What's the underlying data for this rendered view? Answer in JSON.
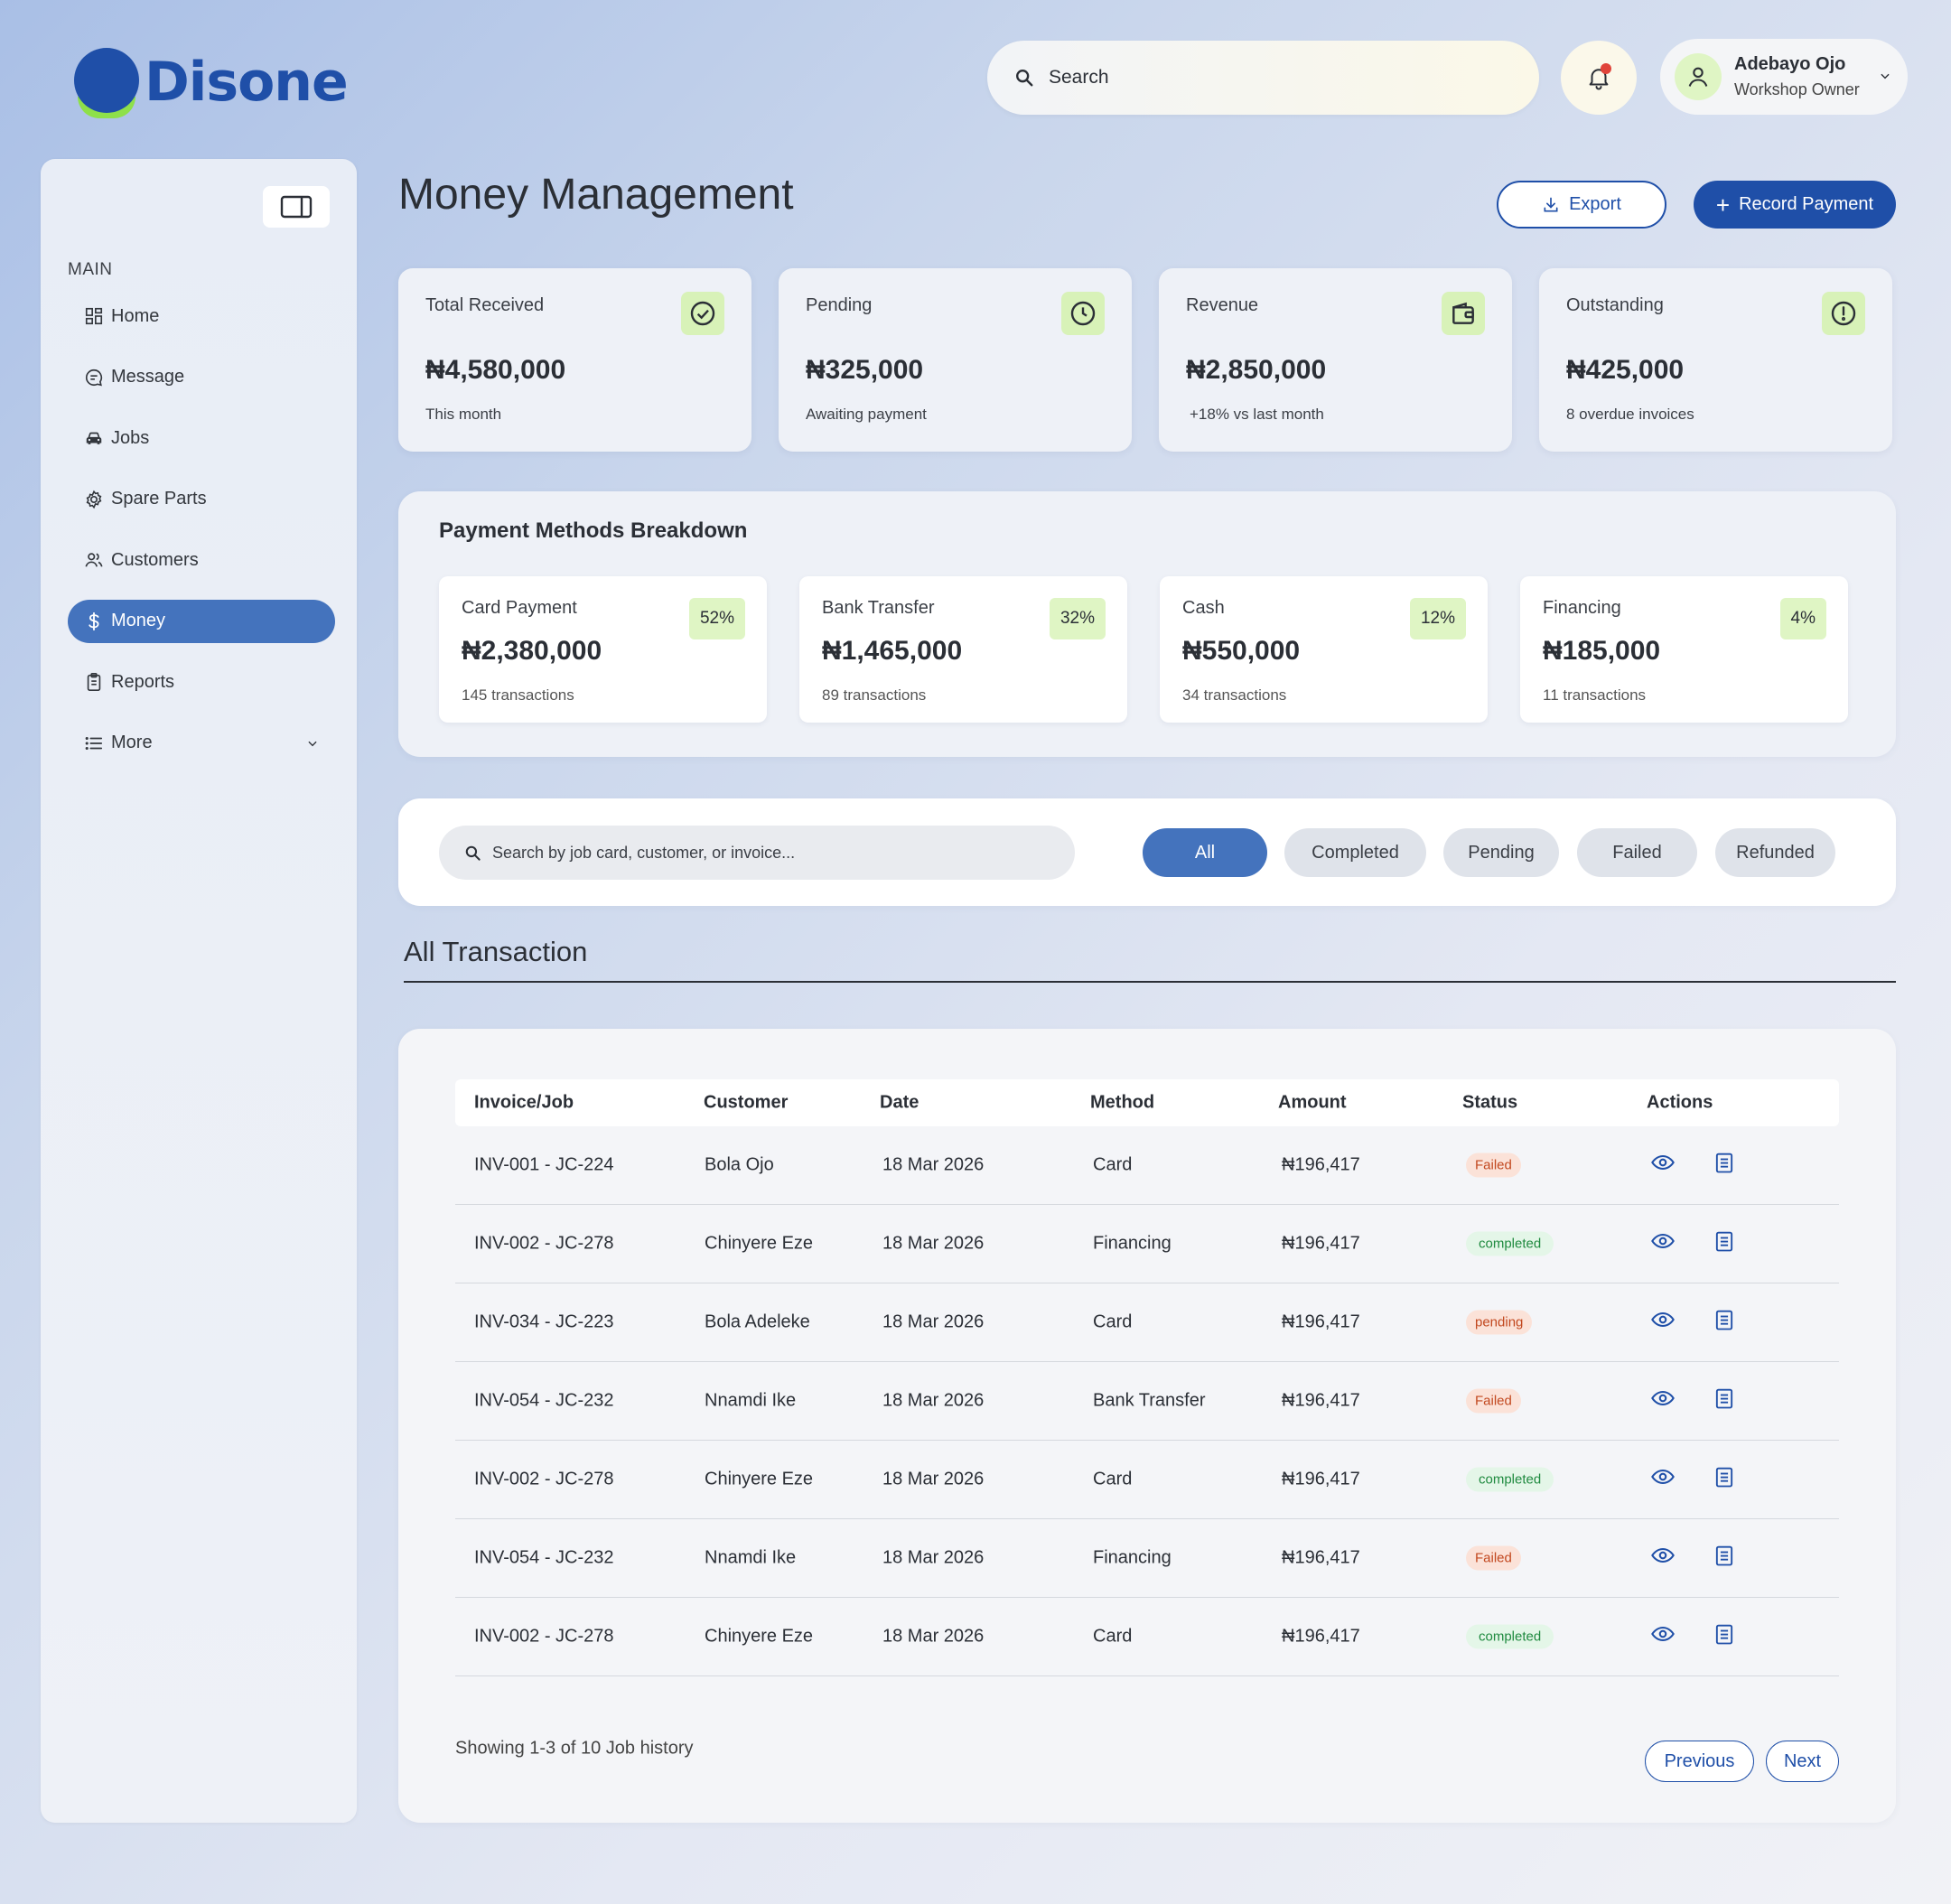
{
  "brand": {
    "name": "Disone"
  },
  "header": {
    "search_placeholder": "Search",
    "user": {
      "name": "Adebayo Ojo",
      "role": "Workshop Owner"
    }
  },
  "sidebar": {
    "section_label": "MAIN",
    "items": [
      {
        "label": "Home",
        "icon": "grid-icon"
      },
      {
        "label": "Message",
        "icon": "message-icon"
      },
      {
        "label": "Jobs",
        "icon": "car-icon"
      },
      {
        "label": "Spare Parts",
        "icon": "gear-icon"
      },
      {
        "label": "Customers",
        "icon": "users-icon"
      },
      {
        "label": "Money",
        "icon": "dollar-icon",
        "active": true
      },
      {
        "label": "Reports",
        "icon": "clipboard-icon"
      },
      {
        "label": "More",
        "icon": "list-icon"
      }
    ]
  },
  "page": {
    "title": "Money Management",
    "export_label": "Export",
    "record_label": "Record Payment"
  },
  "stats": [
    {
      "label": "Total Received",
      "value": "₦4,580,000",
      "sub": "This month",
      "icon": "check-circle-icon"
    },
    {
      "label": "Pending",
      "value": "₦325,000",
      "sub": "Awaiting payment",
      "icon": "clock-icon"
    },
    {
      "label": "Revenue",
      "value": "₦2,850,000",
      "sub": "+18% vs last month",
      "icon": "wallet-icon"
    },
    {
      "label": "Outstanding",
      "value": "₦425,000",
      "sub": "8 overdue invoices",
      "icon": "alert-circle-icon"
    }
  ],
  "breakdown": {
    "title": "Payment Methods Breakdown",
    "methods": [
      {
        "name": "Card Payment",
        "value": "₦2,380,000",
        "sub": "145 transactions",
        "pct": "52%"
      },
      {
        "name": "Bank Transfer",
        "value": "₦1,465,000",
        "sub": "89 transactions",
        "pct": "32%"
      },
      {
        "name": "Cash",
        "value": "₦550,000",
        "sub": "34 transactions",
        "pct": "12%"
      },
      {
        "name": "Financing",
        "value": "₦185,000",
        "sub": "11 transactions",
        "pct": "4%"
      }
    ]
  },
  "filters": {
    "search_placeholder": "Search by job card, customer, or invoice...",
    "chips": [
      "All",
      "Completed",
      "Pending",
      "Failed",
      "Refunded"
    ],
    "active": "All"
  },
  "transactions": {
    "title": "All Transaction",
    "columns": [
      "Invoice/Job",
      "Customer",
      "Date",
      "Method",
      "Amount",
      "Status",
      "Actions"
    ],
    "rows": [
      {
        "invoice": "INV-001 - JC-224",
        "customer": "Bola Ojo",
        "date": "18 Mar 2026",
        "method": "Card",
        "amount": "₦196,417",
        "status": "Failed"
      },
      {
        "invoice": "INV-002 - JC-278",
        "customer": "Chinyere Eze",
        "date": "18 Mar 2026",
        "method": "Financing",
        "amount": "₦196,417",
        "status": "completed"
      },
      {
        "invoice": "INV-034 - JC-223",
        "customer": "Bola Adeleke",
        "date": "18 Mar 2026",
        "method": "Card",
        "amount": "₦196,417",
        "status": "pending"
      },
      {
        "invoice": "INV-054 - JC-232",
        "customer": "Nnamdi Ike",
        "date": "18 Mar 2026",
        "method": "Bank Transfer",
        "amount": "₦196,417",
        "status": "Failed"
      },
      {
        "invoice": "INV-002 - JC-278",
        "customer": "Chinyere Eze",
        "date": "18 Mar 2026",
        "method": "Card",
        "amount": "₦196,417",
        "status": "completed"
      },
      {
        "invoice": "INV-054 - JC-232",
        "customer": "Nnamdi Ike",
        "date": "18 Mar 2026",
        "method": "Financing",
        "amount": "₦196,417",
        "status": "Failed"
      },
      {
        "invoice": "INV-002 - JC-278",
        "customer": "Chinyere Eze",
        "date": "18 Mar 2026",
        "method": "Card",
        "amount": "₦196,417",
        "status": "completed"
      }
    ],
    "footer": "Showing 1-3 of 10 Job history",
    "prev_label": "Previous",
    "next_label": "Next"
  },
  "colors": {
    "brand_blue": "#1f4fa8",
    "nav_active": "#4473bd",
    "accent_green": "#d8f2b8",
    "failed": "#c2481f",
    "completed": "#1f8a3f"
  }
}
